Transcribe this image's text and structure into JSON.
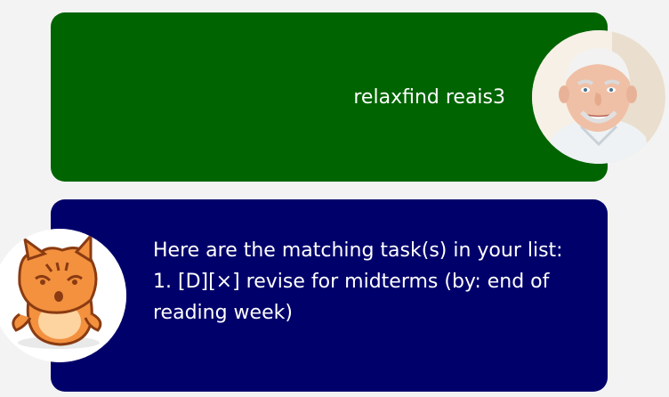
{
  "conversation": {
    "user_message": {
      "text": "relaxfind reais3",
      "avatar_icon": "old-man-avatar-icon"
    },
    "bot_message": {
      "lines": [
        "Here are the matching task(s) in your list:",
        "1. [D][×] revise for midterms (by: end of reading week)"
      ],
      "avatar_icon": "orange-cat-avatar-icon"
    }
  },
  "colors": {
    "background": "#f3f3f3",
    "user_bubble": "#006400",
    "bot_bubble": "#00006b",
    "text": "#ffffff"
  }
}
